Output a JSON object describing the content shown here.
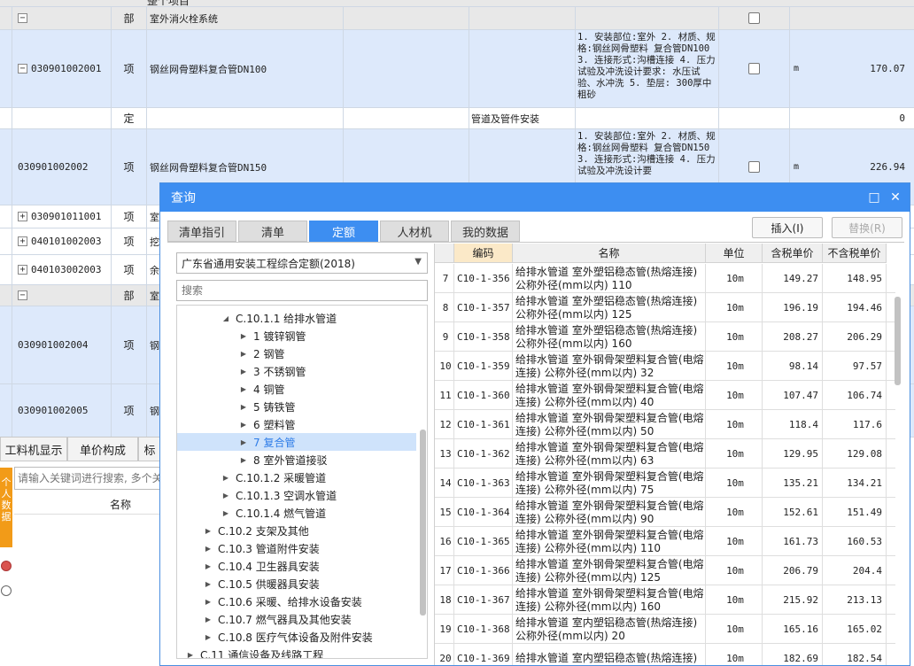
{
  "background_grid": {
    "top_partial_text": "整个项目",
    "rows": [
      {
        "code": "",
        "type": "部",
        "name": "室外消火栓系统",
        "feature": "",
        "work": "",
        "unit": "",
        "qty": "",
        "expand": "−"
      },
      {
        "code": "030901002001",
        "type": "项",
        "name": "钢丝网骨塑料复合管DN100",
        "feature": "1. 安装部位:室外 2. 材质、规格:钢丝网骨塑料 复合管DN100 3. 连接形式:沟槽连接 4. 压力试验及冲洗设计要求: 水压试验、水冲洗 5. 垫层: 300厚中粗砂",
        "work": "",
        "unit": "m",
        "qty": "170.07",
        "expand": "−"
      },
      {
        "code": "",
        "type": "定",
        "name": "",
        "feature": "",
        "work": "管道及管件安装",
        "unit": "",
        "qty": "0",
        "expand": ""
      },
      {
        "code": "030901002002",
        "type": "项",
        "name": "钢丝网骨塑料复合管DN150",
        "feature": "1. 安装部位:室外 2. 材质、规格:钢丝网骨塑料 复合管DN150 3. 连接形式:沟槽连接 4. 压力试验及冲洗设计要",
        "work": "",
        "unit": "m",
        "qty": "226.94",
        "expand": ""
      },
      {
        "code": "030901011001",
        "type": "项",
        "name": "室",
        "feature": "",
        "work": "",
        "unit": "",
        "qty": "",
        "expand": "+"
      },
      {
        "code": "040101002003",
        "type": "项",
        "name": "挖",
        "feature": "",
        "work": "",
        "unit": "",
        "qty": "",
        "expand": "+"
      },
      {
        "code": "040103002003",
        "type": "项",
        "name": "余",
        "feature": "",
        "work": "",
        "unit": "",
        "qty": "",
        "expand": "+"
      },
      {
        "code": "",
        "type": "部",
        "name": "室",
        "feature": "",
        "work": "",
        "unit": "",
        "qty": "",
        "expand": "−"
      },
      {
        "code": "030901002004",
        "type": "项",
        "name": "钢",
        "feature": "",
        "work": "",
        "unit": "",
        "qty": "",
        "expand": ""
      },
      {
        "code": "030901002005",
        "type": "项",
        "name": "钢",
        "feature": "",
        "work": "",
        "unit": "",
        "qty": "",
        "expand": ""
      }
    ]
  },
  "bottom_panel": {
    "tabs": [
      "工料机显示",
      "单价构成",
      "标"
    ],
    "search_placeholder": "请输入关键词进行搜索, 多个关",
    "name_header": "名称",
    "side_label": "个人数据"
  },
  "dialog": {
    "title": "查询",
    "tabs": [
      "清单指引",
      "清单",
      "定额",
      "人材机",
      "我的数据"
    ],
    "active_tab": "定额",
    "insert_button": "插入(I)",
    "replace_button": "替换(R)",
    "library": "广东省通用安装工程综合定额(2018)",
    "search_placeholder": "搜索",
    "tree": [
      {
        "label": "C.10.1.1 给排水管道",
        "depth": 2,
        "open": true
      },
      {
        "label": "1 镀锌钢管",
        "depth": 3
      },
      {
        "label": "2 钢管",
        "depth": 3
      },
      {
        "label": "3 不锈钢管",
        "depth": 3
      },
      {
        "label": "4 铜管",
        "depth": 3
      },
      {
        "label": "5 铸铁管",
        "depth": 3
      },
      {
        "label": "6 塑料管",
        "depth": 3
      },
      {
        "label": "7 复合管",
        "depth": 3,
        "selected": true
      },
      {
        "label": "8 室外管道接驳",
        "depth": 3
      },
      {
        "label": "C.10.1.2 采暖管道",
        "depth": 2
      },
      {
        "label": "C.10.1.3 空调水管道",
        "depth": 2
      },
      {
        "label": "C.10.1.4 燃气管道",
        "depth": 2
      },
      {
        "label": "C.10.2 支架及其他",
        "depth": 1
      },
      {
        "label": "C.10.3 管道附件安装",
        "depth": 1
      },
      {
        "label": "C.10.4 卫生器具安装",
        "depth": 1
      },
      {
        "label": "C.10.5 供暖器具安装",
        "depth": 1
      },
      {
        "label": "C.10.6 采暖、给排水设备安装",
        "depth": 1
      },
      {
        "label": "C.10.7 燃气器具及其他安装",
        "depth": 1
      },
      {
        "label": "C.10.8 医疗气体设备及附件安装",
        "depth": 1
      },
      {
        "label": "C.11 通信设备及线路工程",
        "depth": 0
      }
    ],
    "columns": [
      "",
      "编码",
      "名称",
      "单位",
      "含税单价",
      "不含税单价"
    ],
    "rows": [
      {
        "no": "7",
        "code": "C10-1-356",
        "name": "给排水管道 室外塑铝稳态管(热熔连接) 公称外径(mm以内) 110",
        "unit": "10m",
        "tax": "149.27",
        "notax": "148.95"
      },
      {
        "no": "8",
        "code": "C10-1-357",
        "name": "给排水管道 室外塑铝稳态管(热熔连接) 公称外径(mm以内) 125",
        "unit": "10m",
        "tax": "196.19",
        "notax": "194.46"
      },
      {
        "no": "9",
        "code": "C10-1-358",
        "name": "给排水管道 室外塑铝稳态管(热熔连接) 公称外径(mm以内) 160",
        "unit": "10m",
        "tax": "208.27",
        "notax": "206.29"
      },
      {
        "no": "10",
        "code": "C10-1-359",
        "name": "给排水管道 室外钢骨架塑料复合管(电熔连接) 公称外径(mm以内) 32",
        "unit": "10m",
        "tax": "98.14",
        "notax": "97.57"
      },
      {
        "no": "11",
        "code": "C10-1-360",
        "name": "给排水管道 室外钢骨架塑料复合管(电熔连接) 公称外径(mm以内) 40",
        "unit": "10m",
        "tax": "107.47",
        "notax": "106.74"
      },
      {
        "no": "12",
        "code": "C10-1-361",
        "name": "给排水管道 室外钢骨架塑料复合管(电熔连接) 公称外径(mm以内) 50",
        "unit": "10m",
        "tax": "118.4",
        "notax": "117.6"
      },
      {
        "no": "13",
        "code": "C10-1-362",
        "name": "给排水管道 室外钢骨架塑料复合管(电熔连接) 公称外径(mm以内) 63",
        "unit": "10m",
        "tax": "129.95",
        "notax": "129.08"
      },
      {
        "no": "14",
        "code": "C10-1-363",
        "name": "给排水管道 室外钢骨架塑料复合管(电熔连接) 公称外径(mm以内) 75",
        "unit": "10m",
        "tax": "135.21",
        "notax": "134.21"
      },
      {
        "no": "15",
        "code": "C10-1-364",
        "name": "给排水管道 室外钢骨架塑料复合管(电熔连接) 公称外径(mm以内) 90",
        "unit": "10m",
        "tax": "152.61",
        "notax": "151.49"
      },
      {
        "no": "16",
        "code": "C10-1-365",
        "name": "给排水管道 室外钢骨架塑料复合管(电熔连接) 公称外径(mm以内) 110",
        "unit": "10m",
        "tax": "161.73",
        "notax": "160.53"
      },
      {
        "no": "17",
        "code": "C10-1-366",
        "name": "给排水管道 室外钢骨架塑料复合管(电熔连接) 公称外径(mm以内) 125",
        "unit": "10m",
        "tax": "206.79",
        "notax": "204.4"
      },
      {
        "no": "18",
        "code": "C10-1-367",
        "name": "给排水管道 室外钢骨架塑料复合管(电熔连接) 公称外径(mm以内) 160",
        "unit": "10m",
        "tax": "215.92",
        "notax": "213.13"
      },
      {
        "no": "19",
        "code": "C10-1-368",
        "name": "给排水管道 室内塑铝稳态管(热熔连接) 公称外径(mm以内) 20",
        "unit": "10m",
        "tax": "165.16",
        "notax": "165.02"
      },
      {
        "no": "20",
        "code": "C10-1-369",
        "name": "给排水管道 室内塑铝稳态管(热熔连接)",
        "unit": "10m",
        "tax": "182.69",
        "notax": "182.54"
      }
    ]
  }
}
